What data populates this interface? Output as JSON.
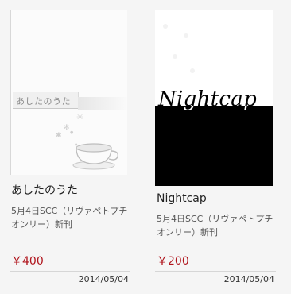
{
  "products": [
    {
      "cover_title": "あしたのうた",
      "name": "あしたのうた",
      "description": "5月4日SCC（リヴァペトプチオンリー）新刊",
      "price": "￥400",
      "date": "2014/05/04"
    },
    {
      "cover_title": "Nightcap",
      "name": "Nightcap",
      "description": "5月4日SCC（リヴァペトプチオンリー）新刊",
      "price": "￥200",
      "date": "2014/05/04"
    }
  ],
  "colors": {
    "price": "#b0141c",
    "background": "#f5f5f5",
    "divider": "#d6d6d6"
  },
  "icons": [
    "sparkle-icon",
    "teacup-illustration"
  ]
}
